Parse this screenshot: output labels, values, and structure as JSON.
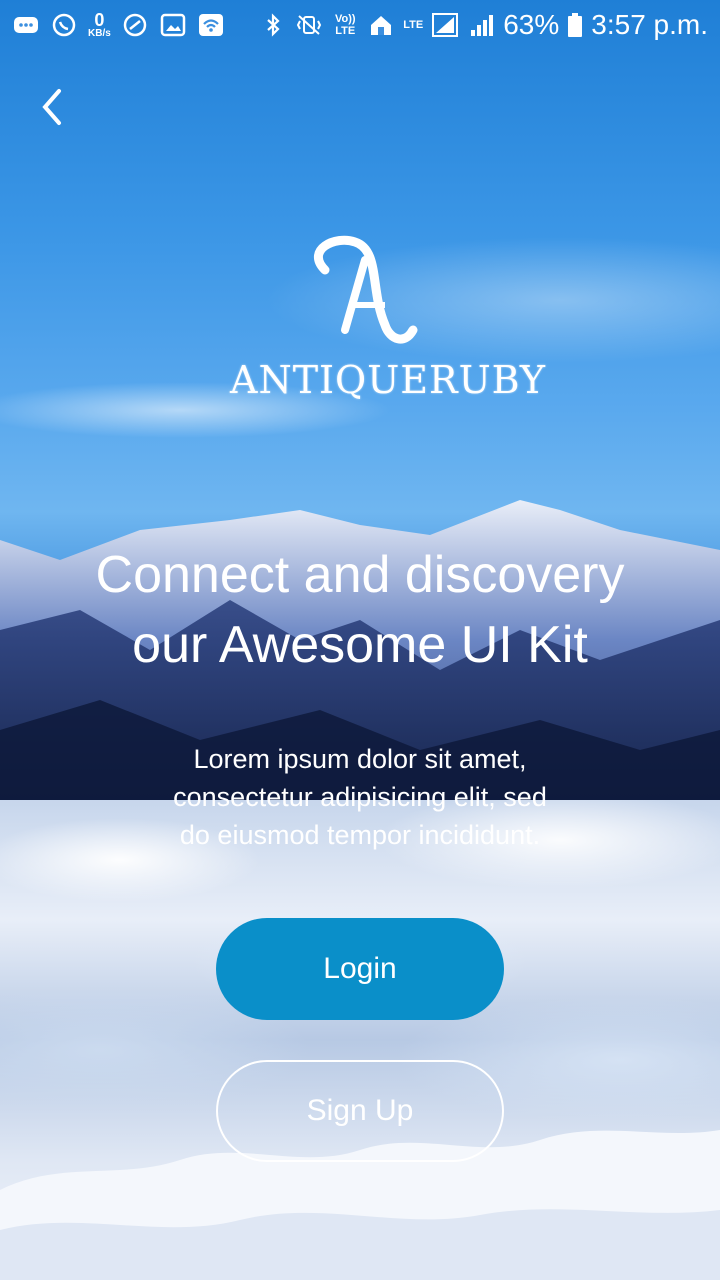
{
  "status_bar": {
    "kbs_value": "0",
    "kbs_unit": "KB/s",
    "lte_label": "LTE",
    "volte_label": "Vo)) LTE",
    "battery_percent": "63%",
    "time": "3:57 p.m."
  },
  "logo": {
    "brand_name": "ANTIQUERUBY"
  },
  "hero": {
    "headline_line1": "Connect and discovery",
    "headline_line2": "our Awesome UI Kit",
    "subtitle_line1": "Lorem ipsum dolor sit amet,",
    "subtitle_line2": "consectetur adipisicing elit, sed",
    "subtitle_line3": "do eiusmod tempor incididunt."
  },
  "actions": {
    "login_label": "Login",
    "signup_label": "Sign Up"
  },
  "colors": {
    "login_button": "#0a8fc9",
    "sky_top": "#1f7fd6"
  }
}
